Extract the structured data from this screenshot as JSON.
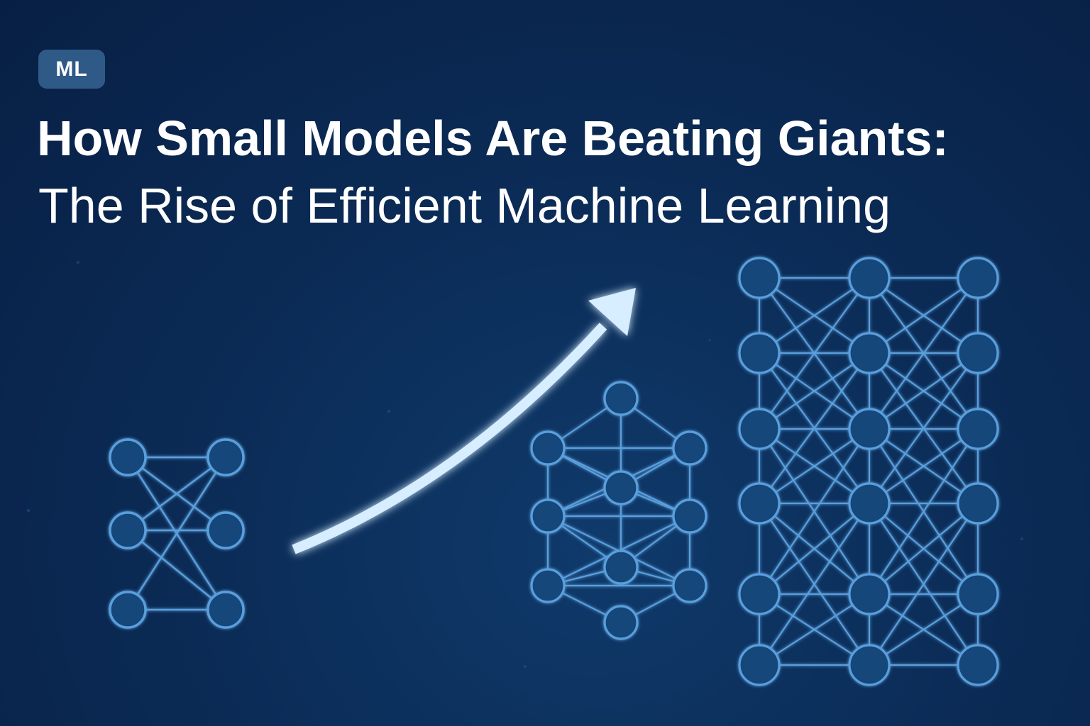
{
  "badge": {
    "label": "ML"
  },
  "headline": {
    "title": "How Small Models Are Beating Giants:",
    "subtitle": "The Rise of Efficient Machine Learning"
  },
  "colors": {
    "background": "#0b2c57",
    "node_fill": "#15477a",
    "line": "#5a9fdc",
    "arrow": "#d6eeff",
    "badge": "#2f5a87"
  },
  "illustration": {
    "networks": [
      "small-network",
      "medium-network",
      "large-network"
    ],
    "arrow": "upward-trend-arrow"
  }
}
